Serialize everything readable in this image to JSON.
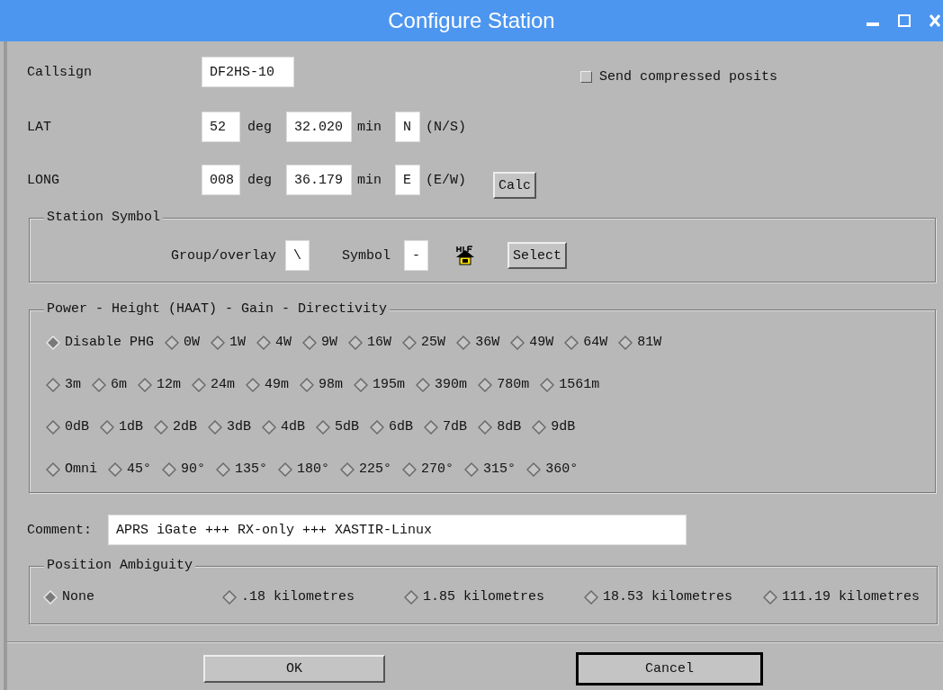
{
  "window": {
    "title": "Configure Station"
  },
  "callsign": {
    "label": "Callsign",
    "value": "DF2HS-10"
  },
  "compressed": {
    "label": "Send compressed posits",
    "checked": false
  },
  "coords": [
    {
      "label": "LAT",
      "deg": "52",
      "deg_unit": "deg",
      "min": "32.020",
      "min_unit": "min",
      "hemisphere": "N",
      "hint": "(N/S)"
    },
    {
      "label": "LONG",
      "deg": "008",
      "deg_unit": "deg",
      "min": "36.179",
      "min_unit": "min",
      "hemisphere": "E",
      "hint": "(E/W)"
    }
  ],
  "calc_button": "Calc",
  "station_symbol": {
    "title": "Station Symbol",
    "group_label": "Group/overlay",
    "group_value": "\\",
    "symbol_label": "Symbol",
    "symbol_value": "-",
    "select_button": "Select"
  },
  "phg": {
    "title": "Power - Height (HAAT) - Gain - Directivity",
    "power": [
      {
        "label": "Disable PHG",
        "selected": true
      },
      {
        "label": "0W",
        "selected": false
      },
      {
        "label": "1W",
        "selected": false
      },
      {
        "label": "4W",
        "selected": false
      },
      {
        "label": "9W",
        "selected": false
      },
      {
        "label": "16W",
        "selected": false
      },
      {
        "label": "25W",
        "selected": false
      },
      {
        "label": "36W",
        "selected": false
      },
      {
        "label": "49W",
        "selected": false
      },
      {
        "label": "64W",
        "selected": false
      },
      {
        "label": "81W",
        "selected": false
      }
    ],
    "height": [
      {
        "label": "3m",
        "selected": false
      },
      {
        "label": "6m",
        "selected": false
      },
      {
        "label": "12m",
        "selected": false
      },
      {
        "label": "24m",
        "selected": false
      },
      {
        "label": "49m",
        "selected": false
      },
      {
        "label": "98m",
        "selected": false
      },
      {
        "label": "195m",
        "selected": false
      },
      {
        "label": "390m",
        "selected": false
      },
      {
        "label": "780m",
        "selected": false
      },
      {
        "label": "1561m",
        "selected": false
      }
    ],
    "gain": [
      {
        "label": "0dB",
        "selected": false
      },
      {
        "label": "1dB",
        "selected": false
      },
      {
        "label": "2dB",
        "selected": false
      },
      {
        "label": "3dB",
        "selected": false
      },
      {
        "label": "4dB",
        "selected": false
      },
      {
        "label": "5dB",
        "selected": false
      },
      {
        "label": "6dB",
        "selected": false
      },
      {
        "label": "7dB",
        "selected": false
      },
      {
        "label": "8dB",
        "selected": false
      },
      {
        "label": "9dB",
        "selected": false
      }
    ],
    "directivity": [
      {
        "label": "Omni",
        "selected": false
      },
      {
        "label": "45°",
        "selected": false
      },
      {
        "label": "90°",
        "selected": false
      },
      {
        "label": "135°",
        "selected": false
      },
      {
        "label": "180°",
        "selected": false
      },
      {
        "label": "225°",
        "selected": false
      },
      {
        "label": "270°",
        "selected": false
      },
      {
        "label": "315°",
        "selected": false
      },
      {
        "label": "360°",
        "selected": false
      }
    ]
  },
  "comment": {
    "label": "Comment:",
    "value": "APRS iGate +++ RX-only +++ XASTIR-Linux"
  },
  "ambiguity": {
    "title": "Position Ambiguity",
    "options": [
      {
        "label": "None",
        "selected": true
      },
      {
        "label": ".18 kilometres",
        "selected": false
      },
      {
        "label": "1.85 kilometres",
        "selected": false
      },
      {
        "label": "18.53 kilometres",
        "selected": false
      },
      {
        "label": "111.19 kilometres",
        "selected": false
      }
    ]
  },
  "buttons": [
    {
      "label": "OK",
      "focused": false
    },
    {
      "label": "Cancel",
      "focused": true
    }
  ]
}
